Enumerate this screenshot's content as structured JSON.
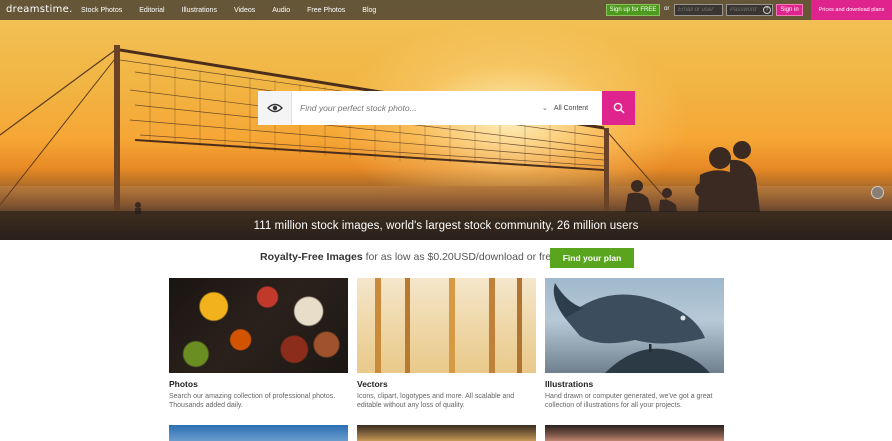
{
  "logo": {
    "text": "dreamstime."
  },
  "nav": {
    "links": [
      "Stock Photos",
      "Editorial",
      "Illustrations",
      "Videos",
      "Audio",
      "Free Photos",
      "Blog"
    ],
    "signup_label": "Sign up for FREE",
    "or_label": "or",
    "email_placeholder": "Email or user",
    "password_placeholder": "Password",
    "signin_label": "Sign in",
    "plans_label": "Prices and download plans"
  },
  "search": {
    "placeholder": "Find your perfect stock photo...",
    "content_type": "All Content"
  },
  "hero": {
    "stats_text": "111 million stock images, world's largest stock community, 26 million users"
  },
  "royalty": {
    "bold": "Royalty-Free Images",
    "rest": " for as low as $0.20USD/download or free",
    "button": "Find your plan"
  },
  "cards": [
    {
      "title": "Photos",
      "desc": "Search our amazing collection of professional photos. Thousands added daily."
    },
    {
      "title": "Vectors",
      "desc": "Icons, clipart, logotypes and more. All scalable and editable without any loss of quality."
    },
    {
      "title": "Illustrations",
      "desc": "Hand drawn or computer generated, we've got a great collection of illustrations for all your projects."
    }
  ],
  "colors": {
    "accent_pink": "#e0248d",
    "accent_green": "#5aa51e"
  }
}
